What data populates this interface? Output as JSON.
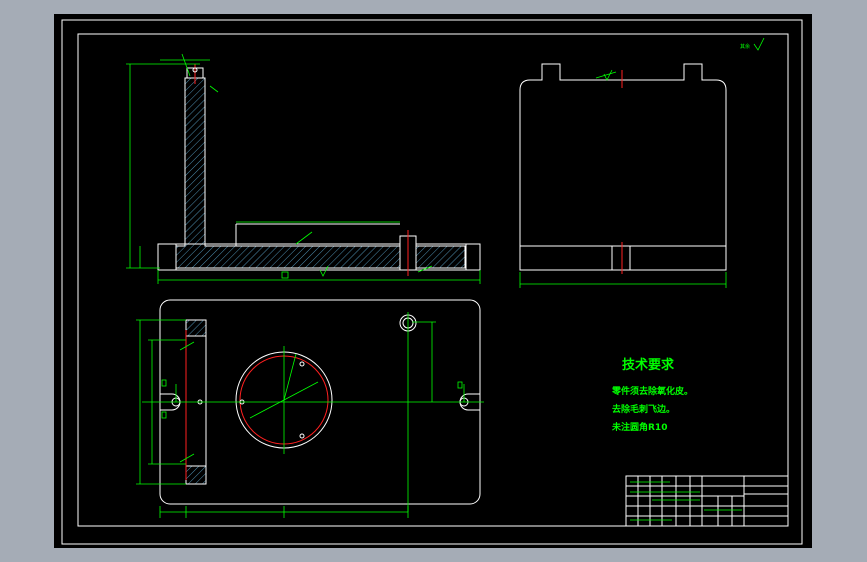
{
  "roughness_note": "其余",
  "tech_requirements": {
    "title": "技术要求",
    "lines": [
      "零件须去除氧化皮。",
      "去除毛刺飞边。",
      "未注圆角R10"
    ]
  },
  "colors": {
    "frame": "#ffffff",
    "dimension": "#00ff00",
    "centerline": "#ff2020",
    "hatch": "#4f8fb0",
    "viewport_border": "#a5acb6"
  }
}
